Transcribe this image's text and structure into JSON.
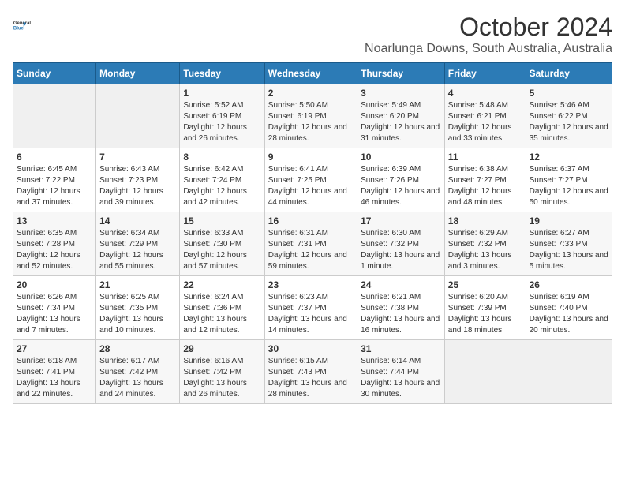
{
  "header": {
    "logo_line1": "General",
    "logo_line2": "Blue",
    "title": "October 2024",
    "subtitle": "Noarlunga Downs, South Australia, Australia"
  },
  "days_of_week": [
    "Sunday",
    "Monday",
    "Tuesday",
    "Wednesday",
    "Thursday",
    "Friday",
    "Saturday"
  ],
  "weeks": [
    [
      {
        "day": "",
        "empty": true
      },
      {
        "day": "",
        "empty": true
      },
      {
        "day": "1",
        "sunrise": "Sunrise: 5:52 AM",
        "sunset": "Sunset: 6:19 PM",
        "daylight": "Daylight: 12 hours and 26 minutes."
      },
      {
        "day": "2",
        "sunrise": "Sunrise: 5:50 AM",
        "sunset": "Sunset: 6:19 PM",
        "daylight": "Daylight: 12 hours and 28 minutes."
      },
      {
        "day": "3",
        "sunrise": "Sunrise: 5:49 AM",
        "sunset": "Sunset: 6:20 PM",
        "daylight": "Daylight: 12 hours and 31 minutes."
      },
      {
        "day": "4",
        "sunrise": "Sunrise: 5:48 AM",
        "sunset": "Sunset: 6:21 PM",
        "daylight": "Daylight: 12 hours and 33 minutes."
      },
      {
        "day": "5",
        "sunrise": "Sunrise: 5:46 AM",
        "sunset": "Sunset: 6:22 PM",
        "daylight": "Daylight: 12 hours and 35 minutes."
      }
    ],
    [
      {
        "day": "6",
        "sunrise": "Sunrise: 6:45 AM",
        "sunset": "Sunset: 7:22 PM",
        "daylight": "Daylight: 12 hours and 37 minutes."
      },
      {
        "day": "7",
        "sunrise": "Sunrise: 6:43 AM",
        "sunset": "Sunset: 7:23 PM",
        "daylight": "Daylight: 12 hours and 39 minutes."
      },
      {
        "day": "8",
        "sunrise": "Sunrise: 6:42 AM",
        "sunset": "Sunset: 7:24 PM",
        "daylight": "Daylight: 12 hours and 42 minutes."
      },
      {
        "day": "9",
        "sunrise": "Sunrise: 6:41 AM",
        "sunset": "Sunset: 7:25 PM",
        "daylight": "Daylight: 12 hours and 44 minutes."
      },
      {
        "day": "10",
        "sunrise": "Sunrise: 6:39 AM",
        "sunset": "Sunset: 7:26 PM",
        "daylight": "Daylight: 12 hours and 46 minutes."
      },
      {
        "day": "11",
        "sunrise": "Sunrise: 6:38 AM",
        "sunset": "Sunset: 7:27 PM",
        "daylight": "Daylight: 12 hours and 48 minutes."
      },
      {
        "day": "12",
        "sunrise": "Sunrise: 6:37 AM",
        "sunset": "Sunset: 7:27 PM",
        "daylight": "Daylight: 12 hours and 50 minutes."
      }
    ],
    [
      {
        "day": "13",
        "sunrise": "Sunrise: 6:35 AM",
        "sunset": "Sunset: 7:28 PM",
        "daylight": "Daylight: 12 hours and 52 minutes."
      },
      {
        "day": "14",
        "sunrise": "Sunrise: 6:34 AM",
        "sunset": "Sunset: 7:29 PM",
        "daylight": "Daylight: 12 hours and 55 minutes."
      },
      {
        "day": "15",
        "sunrise": "Sunrise: 6:33 AM",
        "sunset": "Sunset: 7:30 PM",
        "daylight": "Daylight: 12 hours and 57 minutes."
      },
      {
        "day": "16",
        "sunrise": "Sunrise: 6:31 AM",
        "sunset": "Sunset: 7:31 PM",
        "daylight": "Daylight: 12 hours and 59 minutes."
      },
      {
        "day": "17",
        "sunrise": "Sunrise: 6:30 AM",
        "sunset": "Sunset: 7:32 PM",
        "daylight": "Daylight: 13 hours and 1 minute."
      },
      {
        "day": "18",
        "sunrise": "Sunrise: 6:29 AM",
        "sunset": "Sunset: 7:32 PM",
        "daylight": "Daylight: 13 hours and 3 minutes."
      },
      {
        "day": "19",
        "sunrise": "Sunrise: 6:27 AM",
        "sunset": "Sunset: 7:33 PM",
        "daylight": "Daylight: 13 hours and 5 minutes."
      }
    ],
    [
      {
        "day": "20",
        "sunrise": "Sunrise: 6:26 AM",
        "sunset": "Sunset: 7:34 PM",
        "daylight": "Daylight: 13 hours and 7 minutes."
      },
      {
        "day": "21",
        "sunrise": "Sunrise: 6:25 AM",
        "sunset": "Sunset: 7:35 PM",
        "daylight": "Daylight: 13 hours and 10 minutes."
      },
      {
        "day": "22",
        "sunrise": "Sunrise: 6:24 AM",
        "sunset": "Sunset: 7:36 PM",
        "daylight": "Daylight: 13 hours and 12 minutes."
      },
      {
        "day": "23",
        "sunrise": "Sunrise: 6:23 AM",
        "sunset": "Sunset: 7:37 PM",
        "daylight": "Daylight: 13 hours and 14 minutes."
      },
      {
        "day": "24",
        "sunrise": "Sunrise: 6:21 AM",
        "sunset": "Sunset: 7:38 PM",
        "daylight": "Daylight: 13 hours and 16 minutes."
      },
      {
        "day": "25",
        "sunrise": "Sunrise: 6:20 AM",
        "sunset": "Sunset: 7:39 PM",
        "daylight": "Daylight: 13 hours and 18 minutes."
      },
      {
        "day": "26",
        "sunrise": "Sunrise: 6:19 AM",
        "sunset": "Sunset: 7:40 PM",
        "daylight": "Daylight: 13 hours and 20 minutes."
      }
    ],
    [
      {
        "day": "27",
        "sunrise": "Sunrise: 6:18 AM",
        "sunset": "Sunset: 7:41 PM",
        "daylight": "Daylight: 13 hours and 22 minutes."
      },
      {
        "day": "28",
        "sunrise": "Sunrise: 6:17 AM",
        "sunset": "Sunset: 7:42 PM",
        "daylight": "Daylight: 13 hours and 24 minutes."
      },
      {
        "day": "29",
        "sunrise": "Sunrise: 6:16 AM",
        "sunset": "Sunset: 7:42 PM",
        "daylight": "Daylight: 13 hours and 26 minutes."
      },
      {
        "day": "30",
        "sunrise": "Sunrise: 6:15 AM",
        "sunset": "Sunset: 7:43 PM",
        "daylight": "Daylight: 13 hours and 28 minutes."
      },
      {
        "day": "31",
        "sunrise": "Sunrise: 6:14 AM",
        "sunset": "Sunset: 7:44 PM",
        "daylight": "Daylight: 13 hours and 30 minutes."
      },
      {
        "day": "",
        "empty": true
      },
      {
        "day": "",
        "empty": true
      }
    ]
  ]
}
